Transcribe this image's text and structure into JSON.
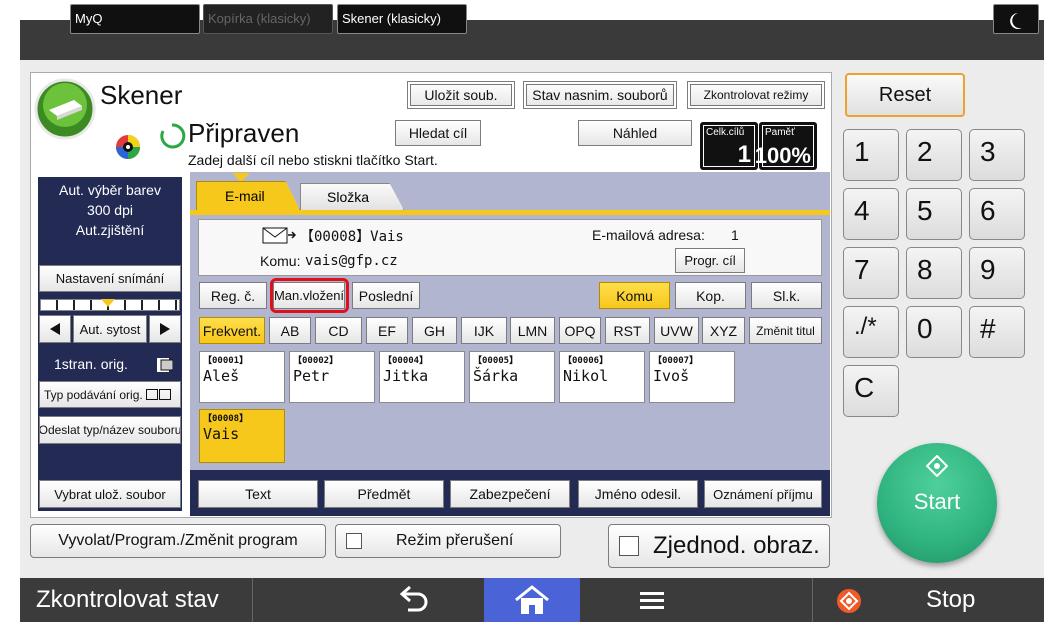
{
  "top_bar": {
    "tab_myq": "MyQ",
    "tab_copier": "Kopírka (klasicky)",
    "tab_scanner": "Skener (klasicky)",
    "moon_icon": "moon-icon"
  },
  "header": {
    "app_title": "Skener",
    "save_file": "Uložit soub.",
    "stored_status": "Stav nasnim. souborů",
    "check_modes": "Zkontrolovat režimy",
    "status": "Připraven",
    "status_hint": "Zadej další cíl nebo stiskni tlačítko Start.",
    "search_dest": "Hledat cíl",
    "preview": "Náhled",
    "total_dest_label": "Celk.cílů",
    "total_dest_value": "1",
    "memory_label": "Paměť",
    "memory_value": "100%"
  },
  "left_panel": {
    "scan_info_1": "Aut. výběr barev",
    "scan_info_2": "300 dpi",
    "scan_info_3": "Aut.zjištění",
    "scan_settings": "Nastavení snímání",
    "auto_density": "Aut. sytost",
    "one_side": "1stran. orig.",
    "feed_type": "Typ podávání orig.",
    "send_type": "Odeslat typ/název souboru",
    "select_stored": "Vybrat ulož. soubor"
  },
  "tabs": {
    "email": "E-mail",
    "folder": "Složka"
  },
  "destination": {
    "code": "【00008】Vais",
    "to_label": "Komu:",
    "to_value": "vais@gfp.cz",
    "email_count_label": "E-mailová adresa:",
    "email_count_value": "1",
    "prog_dest": "Progr. cíl"
  },
  "entry_row": {
    "reg_no": "Reg. č.",
    "manual": "Man.vložení",
    "last": "Poslední",
    "to": "Komu",
    "cc": "Kop.",
    "bcc": "Sl.k."
  },
  "index_tabs": [
    "Frekvent.",
    "AB",
    "CD",
    "EF",
    "GH",
    "IJK",
    "LMN",
    "OPQ",
    "RST",
    "UVW",
    "XYZ"
  ],
  "change_title": "Změnit titul",
  "addresses": [
    {
      "num": "【00001】",
      "name": "Aleš"
    },
    {
      "num": "【00002】",
      "name": "Petr"
    },
    {
      "num": "【00004】",
      "name": "Jitka"
    },
    {
      "num": "【00005】",
      "name": "Šárka"
    },
    {
      "num": "【00006】",
      "name": "Nikol"
    },
    {
      "num": "【00007】",
      "name": "Ivoš"
    },
    {
      "num": "【00008】",
      "name": "Vais"
    }
  ],
  "bottom_fields": {
    "text": "Text",
    "subject": "Předmět",
    "security": "Zabezpečení",
    "sender": "Jméno odesil.",
    "receipt": "Oznámení příjmu"
  },
  "footer_buttons": {
    "recall_program": "Vyvolat/Program./Změnit program",
    "interrupt": "Režim přerušení",
    "simplified": "Zjednod. obraz."
  },
  "keypad": {
    "reset": "Reset",
    "keys": [
      "1",
      "2",
      "3",
      "4",
      "5",
      "6",
      "7",
      "8",
      "9",
      "./*",
      "0",
      "#",
      "C"
    ],
    "start": "Start"
  },
  "bottom_bar": {
    "check_status": "Zkontrolovat stav",
    "stop": "Stop"
  },
  "colors": {
    "accent_yellow": "#f7c81c",
    "start_green": "#2fb37e",
    "reset_orange": "#f0a030",
    "highlight_red": "#e0101a",
    "home_blue": "#4a64d8"
  }
}
